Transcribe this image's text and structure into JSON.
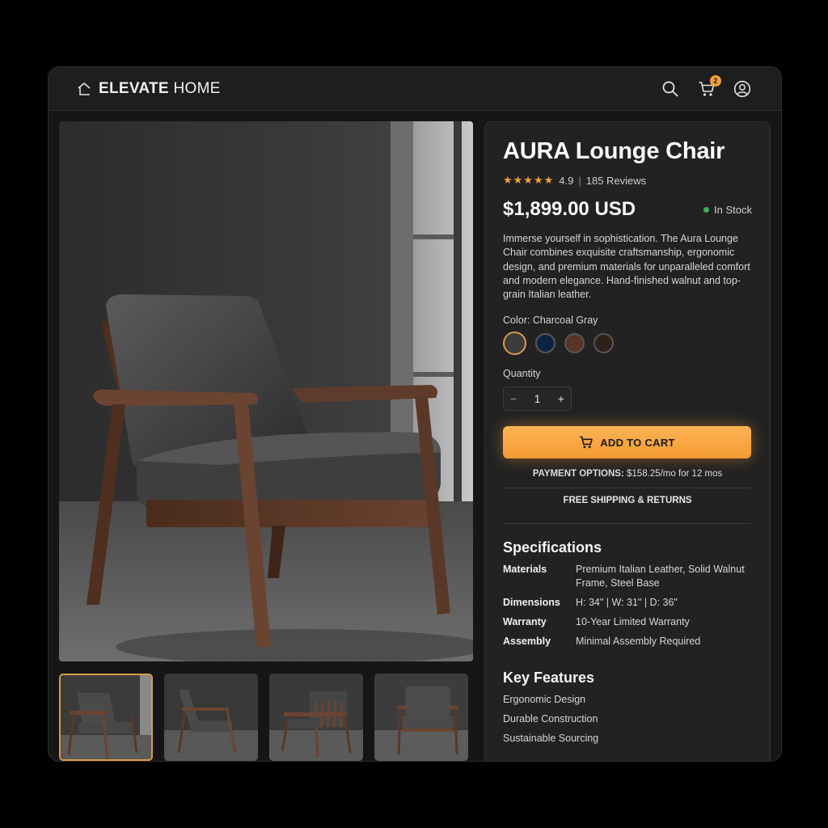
{
  "header": {
    "brand_bold": "ELEVATE",
    "brand_light": " HOME",
    "cart_count": "2",
    "icons": [
      "home-outline-icon",
      "search-icon",
      "cart-icon",
      "user-icon"
    ]
  },
  "gallery": {
    "main_image": "walnut lounge chair with charcoal leather cushions",
    "thumbnails": [
      "front three-quarter view",
      "side view",
      "rear view",
      "front view"
    ],
    "active_thumbnail": 0
  },
  "product": {
    "title": "AURA Lounge Chair",
    "stars": "★★★★★",
    "rating": "4.9",
    "separator": "|",
    "reviews": "185 Reviews",
    "price": "$1,899.00 USD",
    "stock": "In Stock",
    "description": "Immerse yourself in sophistication. The Aura Lounge Chair combines exquisite craftsmanship, ergonomic design, and premium materials for unparalleled comfort and modern elegance. Hand-finished walnut and top-grain Italian leather.",
    "color_label": "Color: Charcoal Gray",
    "swatches": [
      "#3c3c3c",
      "#0e2344",
      "#5a3424",
      "#2f2019"
    ],
    "selected_swatch": 0,
    "quantity_label": "Quantity",
    "quantity": "1",
    "minus": "−",
    "plus": "+",
    "add_to_cart": "ADD TO CART",
    "payment_label": "PAYMENT OPTIONS:",
    "payment_value": " $158.25/mo for 12 mos",
    "shipping": "FREE SHIPPING & RETURNS"
  },
  "specifications": {
    "title": "Specifications",
    "rows": [
      {
        "key": "Materials",
        "value": "Premium Italian Leather, Solid Walnut Frame, Steel Base"
      },
      {
        "key": "Dimensions",
        "value": "H: 34\" | W: 31\" | D: 36\""
      },
      {
        "key": "Warranty",
        "value": "10-Year Limited Warranty"
      },
      {
        "key": "Assembly",
        "value": "Minimal Assembly Required"
      }
    ]
  },
  "features": {
    "title": "Key Features",
    "items": [
      "Ergonomic Design",
      "Durable Construction",
      "Sustainable Sourcing"
    ]
  },
  "colors": {
    "accent": "#f39a33",
    "stock_green": "#3fae55",
    "panel": "#222222"
  }
}
